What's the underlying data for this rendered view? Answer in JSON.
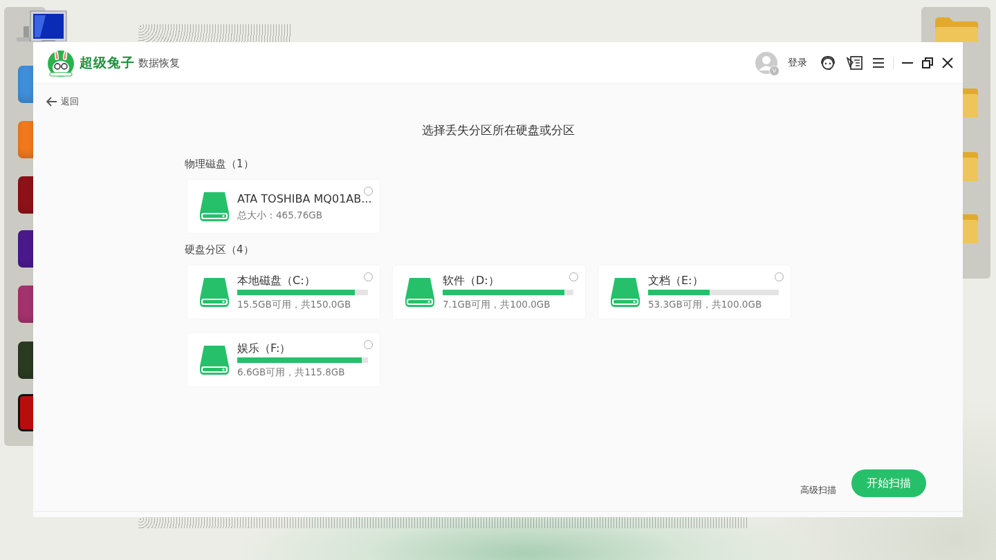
{
  "desktop": {
    "dock_icons": [
      {
        "kind": "app",
        "color": "#3f8fd8"
      },
      {
        "kind": "app",
        "color": "#f0791e"
      },
      {
        "kind": "app",
        "color": "#8e1218"
      },
      {
        "kind": "app",
        "color": "#4a1a8c"
      },
      {
        "kind": "app",
        "color": "#a3336e"
      },
      {
        "kind": "app",
        "color": "#2a3b22"
      },
      {
        "kind": "pdf",
        "color": "#b80d0d"
      }
    ]
  },
  "window": {
    "brand": "超级兔子",
    "product": "数据恢复",
    "avatar_badge": "V",
    "login": "登录",
    "back": "返回",
    "heading": "选择丢失分区所在硬盘或分区",
    "sections": [
      {
        "title": "物理磁盘（1）",
        "cards": [
          {
            "kind": "disk",
            "name": "ATA TOSHIBA MQ01AB...",
            "detail": "总大小：465.76GB",
            "selected": false
          }
        ]
      },
      {
        "title": "硬盘分区（4）",
        "cards": [
          {
            "kind": "partition",
            "name": "本地磁盘（C:）",
            "level": 0.9,
            "detail": "15.5GB可用，共150.0GB",
            "selected": false
          },
          {
            "kind": "partition",
            "name": "软件（D:）",
            "level": 0.93,
            "detail": "7.1GB可用，共100.0GB",
            "selected": false
          },
          {
            "kind": "partition",
            "name": "文档（E:）",
            "level": 0.47,
            "detail": "53.3GB可用，共100.0GB",
            "selected": false
          },
          {
            "kind": "partition",
            "name": "娱乐（F:）",
            "level": 0.95,
            "detail": "6.6GB可用，共115.8GB",
            "selected": false
          }
        ]
      }
    ],
    "advanced": "高级扫描",
    "start": "开始扫描"
  }
}
